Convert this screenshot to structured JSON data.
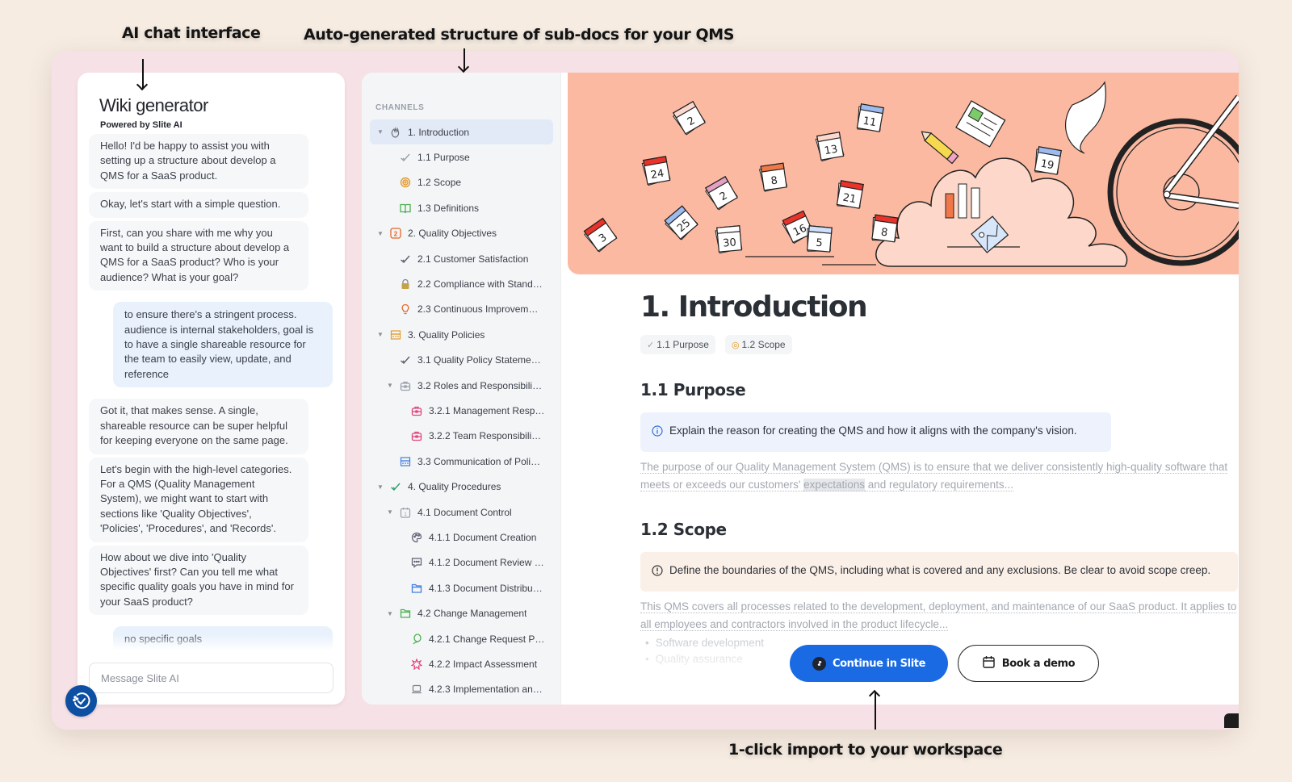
{
  "annotations": {
    "chat": "AI chat interface",
    "structure": "Auto-generated structure of sub-docs for your QMS",
    "import": "1-click import to your workspace"
  },
  "chat": {
    "title": "Wiki generator",
    "subtitle": "Powered by Slite AI",
    "messages": [
      {
        "role": "ai",
        "text": "Hello! I'd be happy to assist you with setting up a structure about develop a QMS for a SaaS product."
      },
      {
        "role": "ai",
        "text": "Okay, let's start with a simple question."
      },
      {
        "role": "ai",
        "text": "First, can you share with me why you want to build a structure about develop a QMS for a SaaS product? Who is your audience? What is your goal?"
      },
      {
        "role": "user",
        "text": "to ensure there's a stringent process. audience is internal stakeholders, goal is to have a single shareable resource for the team to easily view, update, and reference"
      },
      {
        "role": "ai",
        "text": "Got it, that makes sense. A single, shareable resource can be super helpful for keeping everyone on the same page."
      },
      {
        "role": "ai",
        "text": "Let's begin with the high-level categories. For a QMS (Quality Management System), we might want to start with sections like 'Quality Objectives', 'Policies', 'Procedures', and 'Records'."
      },
      {
        "role": "ai",
        "text": "How about we dive into 'Quality Objectives' first? Can you tell me what specific quality goals you have in mind for your SaaS product?"
      },
      {
        "role": "user",
        "text": "no specific goals"
      }
    ],
    "input_placeholder": "Message Slite AI",
    "logo_icon": "slite-ai-check-icon"
  },
  "sidebar": {
    "heading": "CHANNELS",
    "items": [
      {
        "label": "1. Introduction",
        "level": 0,
        "expanded": true,
        "active": true,
        "icon": "wave-hand-icon",
        "color": "#6b7079"
      },
      {
        "label": "1.1 Purpose",
        "level": 1,
        "icon": "double-check-icon",
        "color": "#9aa0aa"
      },
      {
        "label": "1.2 Scope",
        "level": 1,
        "icon": "target-icon",
        "color": "#e39a2a"
      },
      {
        "label": "1.3 Definitions",
        "level": 1,
        "icon": "book-icon",
        "color": "#4caf50"
      },
      {
        "label": "2. Quality Objectives",
        "level": 0,
        "expanded": true,
        "icon": "number-two-icon",
        "color": "#e4682a"
      },
      {
        "label": "2.1 Customer Satisfaction",
        "level": 1,
        "icon": "double-check-icon",
        "color": "#5b6070"
      },
      {
        "label": "2.2 Compliance with Stand…",
        "level": 1,
        "icon": "lock-icon",
        "color": "#c4a24a"
      },
      {
        "label": "2.3 Continuous Improvem…",
        "level": 1,
        "icon": "lightbulb-icon",
        "color": "#e4682a"
      },
      {
        "label": "3. Quality Policies",
        "level": 0,
        "expanded": true,
        "icon": "building-icon",
        "color": "#e39a2a"
      },
      {
        "label": "3.1 Quality Policy Stateme…",
        "level": 1,
        "icon": "double-check-icon",
        "color": "#5b6070"
      },
      {
        "label": "3.2 Roles and Responsibili…",
        "level": 1,
        "expanded": true,
        "icon": "briefcase-icon",
        "color": "#9aa0aa"
      },
      {
        "label": "3.2.1 Management Resp…",
        "level": 2,
        "icon": "briefcase-icon",
        "color": "#e0457b"
      },
      {
        "label": "3.2.2 Team Responsibili…",
        "level": 2,
        "icon": "briefcase-icon",
        "color": "#e0457b"
      },
      {
        "label": "3.3 Communication of Poli…",
        "level": 1,
        "icon": "building-icon",
        "color": "#3f7fe0"
      },
      {
        "label": "4. Quality Procedures",
        "level": 0,
        "expanded": true,
        "icon": "double-check-icon",
        "color": "#2f9e6e"
      },
      {
        "label": "4.1 Document Control",
        "level": 1,
        "expanded": true,
        "icon": "calendar-icon",
        "color": "#9aa0aa"
      },
      {
        "label": "4.1.1 Document Creation",
        "level": 2,
        "icon": "palette-icon",
        "color": "#5b6070"
      },
      {
        "label": "4.1.2 Document Review …",
        "level": 2,
        "icon": "chat-bubble-icon",
        "color": "#5b6070"
      },
      {
        "label": "4.1.3 Document Distribu…",
        "level": 2,
        "icon": "folder-icon",
        "color": "#3f7fe0"
      },
      {
        "label": "4.2 Change Management",
        "level": 1,
        "expanded": true,
        "icon": "folder-icon",
        "color": "#4caf50"
      },
      {
        "label": "4.2.1 Change Request P…",
        "level": 2,
        "icon": "balloon-icon",
        "color": "#4caf50"
      },
      {
        "label": "4.2.2 Impact Assessment",
        "level": 2,
        "icon": "burst-icon",
        "color": "#e0457b"
      },
      {
        "label": "4.2.3 Implementation an…",
        "level": 2,
        "icon": "laptop-icon",
        "color": "#7a7f89"
      }
    ]
  },
  "doc": {
    "title": "1. Introduction",
    "chips": [
      {
        "label": "1.1 Purpose",
        "icon": "double-check-icon"
      },
      {
        "label": "1.2 Scope",
        "icon": "target-icon"
      }
    ],
    "sections": [
      {
        "heading": "1.1 Purpose",
        "callout": "Explain the reason for creating the QMS and how it aligns with the company's vision.",
        "callout_type": "info",
        "body_before": "The purpose of our Quality Management System (QMS) is to ensure that we deliver consistently high-quality software that meets or exceeds our customers' ",
        "body_highlight": "expectations",
        "body_after": " and regulatory requirements..."
      },
      {
        "heading": "1.2 Scope",
        "callout": "Define the boundaries of the QMS, including what is covered and any exclusions. Be clear to avoid scope creep.",
        "callout_type": "warning",
        "body": "This QMS covers all processes related to the development, deployment, and maintenance of our SaaS product. It applies to all employees and contractors involved in the product lifecycle...",
        "bullets": [
          "Software development",
          "Quality assurance"
        ]
      }
    ],
    "cover_calendar_numbers": [
      "2",
      "24",
      "2",
      "8",
      "13",
      "11",
      "21",
      "3",
      "25",
      "30",
      "16",
      "5",
      "8",
      "19"
    ]
  },
  "actions": {
    "continue_label": "Continue in Slite",
    "demo_label": "Book a demo"
  },
  "colors": {
    "primary": "#1a6be3",
    "cover": "#fcb9a1",
    "frame": "#f6e1e7",
    "background": "#f6ece2"
  }
}
